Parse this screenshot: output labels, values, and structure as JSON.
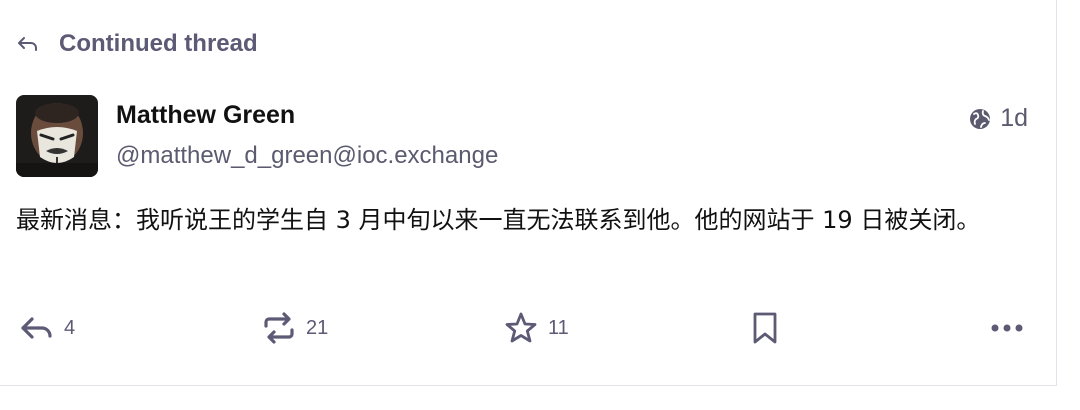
{
  "thread": {
    "label": "Continued thread"
  },
  "author": {
    "display_name": "Matthew Green",
    "handle": "@matthew_d_green@ioc.exchange"
  },
  "meta": {
    "visibility_icon": "globe-icon",
    "age": "1d"
  },
  "post": {
    "content": "最新消息：我听说王的学生自 3 月中旬以来一直无法联系到他。他的网站于 19 日被关闭。"
  },
  "actions": {
    "reply_count": "4",
    "boost_count": "21",
    "favourite_count": "11"
  },
  "colors": {
    "muted": "#5c5a74",
    "text": "#111111",
    "divider": "#e3e1ea"
  }
}
